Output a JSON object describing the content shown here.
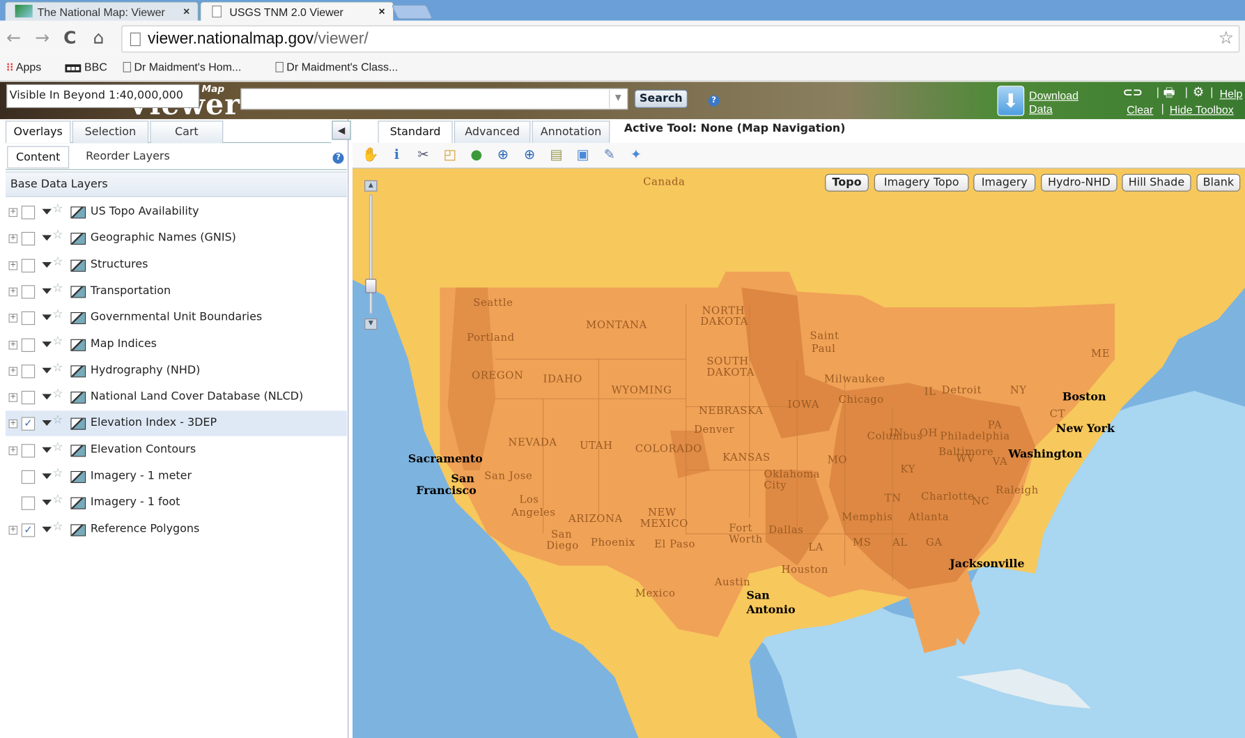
{
  "browser": {
    "tabs": [
      {
        "label": "The National Map: Viewer",
        "close": "×"
      },
      {
        "label": "USGS TNM 2.0 Viewer",
        "close": "×"
      }
    ],
    "url_host": "viewer.nationalmap.gov",
    "url_path": "/viewer/",
    "bookmarks": [
      "Apps",
      "BBC",
      "Dr Maidment's Hom...",
      "Dr Maidment's Class..."
    ]
  },
  "header": {
    "scale_tooltip": "Visible In Beyond 1:40,000,000",
    "logo_text": "Viewer",
    "logo_small": "Map",
    "search_label": "Search",
    "help": "?",
    "download_label_1": "Download",
    "download_label_2": "Data",
    "help_link": "Help",
    "clear_link": "Clear",
    "hide_toolbox_link": "Hide Toolbox",
    "sep": "|"
  },
  "left_panel": {
    "tabs": [
      "Overlays",
      "Selection",
      "Cart"
    ],
    "subtabs": [
      "Content",
      "Reorder Layers"
    ],
    "section_title": "Base Data Layers",
    "layers": [
      {
        "name": "US Topo Availability",
        "checked": false,
        "expandable": true
      },
      {
        "name": "Geographic Names (GNIS)",
        "checked": false,
        "expandable": true
      },
      {
        "name": "Structures",
        "checked": false,
        "expandable": true
      },
      {
        "name": "Transportation",
        "checked": false,
        "expandable": true
      },
      {
        "name": "Governmental Unit Boundaries",
        "checked": false,
        "expandable": true
      },
      {
        "name": "Map Indices",
        "checked": false,
        "expandable": true
      },
      {
        "name": "Hydrography (NHD)",
        "checked": false,
        "expandable": true
      },
      {
        "name": "National Land Cover Database (NLCD)",
        "checked": false,
        "expandable": true
      },
      {
        "name": "Elevation Index - 3DEP",
        "checked": true,
        "expandable": true,
        "selected": true
      },
      {
        "name": "Elevation Contours",
        "checked": false,
        "expandable": true
      },
      {
        "name": "Imagery - 1 meter",
        "checked": false,
        "expandable": false
      },
      {
        "name": "Imagery - 1 foot",
        "checked": false,
        "expandable": false
      },
      {
        "name": "Reference Polygons",
        "checked": true,
        "expandable": true
      }
    ]
  },
  "map_panel": {
    "tabs": [
      "Standard",
      "Advanced",
      "Annotation"
    ],
    "active_tool": "Active Tool: None (Map Navigation)",
    "tools": [
      "pan-icon",
      "identify-icon",
      "measure-icon",
      "select-icon",
      "globe-icon",
      "zoom-in-icon",
      "zoom-box-icon",
      "layers-icon",
      "export-icon",
      "edit-icon",
      "pin-icon"
    ],
    "basemaps": [
      "Topo",
      "Imagery Topo",
      "Imagery",
      "Hydro-NHD",
      "Hill Shade",
      "Blank"
    ],
    "active_basemap": "Topo"
  },
  "map_labels": {
    "countries": [
      "Canada",
      "Mexico"
    ],
    "states": [
      "MONTANA",
      "NORTH",
      "DAKOTA",
      "SOUTH",
      "DAKOTA",
      "OREGON",
      "IDAHO",
      "WYOMING",
      "NEBRASKA",
      "IOWA",
      "NEVADA",
      "UTAH",
      "COLORADO",
      "KANSAS",
      "ARIZONA",
      "NEW",
      "MEXICO",
      "OH",
      "PA",
      "ME",
      "NY",
      "IN",
      "KY",
      "TN",
      "NC",
      "VA",
      "MO",
      "WV",
      "LA",
      "GA",
      "AL",
      "MS",
      "IL",
      "CT"
    ],
    "cities_minor": [
      "Seattle",
      "Portland",
      "Saint",
      "Paul",
      "Milwaukee",
      "Chicago",
      "Detroit",
      "Denver",
      "Columbus",
      "Oklahoma",
      "City",
      "San Jose",
      "Los",
      "Angeles",
      "San",
      "Diego",
      "Phoenix",
      "El Paso",
      "Fort",
      "Worth",
      "Dallas",
      "Memphis",
      "Atlanta",
      "Charlotte",
      "Raleigh",
      "Baltimore",
      "Philadelphia",
      "Houston",
      "Austin"
    ],
    "cities_major": [
      "Sacramento",
      "San",
      "Francisco",
      "Boston",
      "New York",
      "Washington",
      "Jacksonville",
      "San",
      "Antonio"
    ]
  },
  "colors": {
    "water": "#7db3df",
    "coverage_outer": "#f7c85c",
    "coverage_mid": "#f0a257",
    "coverage_dense": "#d9823e",
    "accent": "#3a78c8"
  }
}
